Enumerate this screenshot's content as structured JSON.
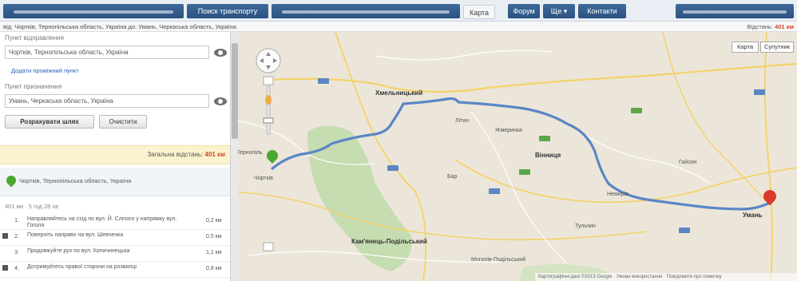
{
  "tabs": {
    "tab1": "",
    "tab2": "Поиск транспорту",
    "tab3": "",
    "tab4": "Карта",
    "tab5": "Форум",
    "tab6": "Ще ▾",
    "tab7": "Контакти",
    "tab8": ""
  },
  "breadcrumb": {
    "route": "від: Чортків, Тернопільська область, Україна  до: Умань, Черкаська область, Україна",
    "distance_label": "Відстань:",
    "distance_value": "401 км"
  },
  "panel": {
    "from_label": "Пункт відправлення",
    "from_value": "Чортків, Тернопільська область, Україна",
    "add_point": "Додати проміжний пункт",
    "to_label": "Пункт призначення",
    "to_value": "Умань, Черкаська область, Україна",
    "calc_button": "Розрахувати шлях",
    "clear_button": "Очистити",
    "total_label": "Загальна відстань:",
    "total_value": "401 км",
    "start_address": "Чортків, Тернопільська область, Україна",
    "summary": "401 км · 5 год 28 хв",
    "steps": [
      {
        "num": "1.",
        "text": "Направляйтесь на схід по вул. Й. Сліпого у напрямку вул. Гоголя",
        "km": "0,2 км"
      },
      {
        "num": "2.",
        "text": "Поверніть направо на вул. Шевченка",
        "km": "0,5 км"
      },
      {
        "num": "3.",
        "text": "Продовжуйте рух по вул. Копичинецька",
        "km": "1,1 км"
      },
      {
        "num": "4.",
        "text": "Дотримуйтесь правої сторони на розвилці",
        "km": "0,8 км"
      }
    ]
  },
  "map": {
    "map_button": "Карта",
    "satellite_button": "Супутник",
    "towns": [
      {
        "name": "Хмельницький",
        "big": true
      },
      {
        "name": "Тернопіль",
        "big": false
      },
      {
        "name": "Кам'янець-Подільський",
        "big": true
      },
      {
        "name": "Вінниця",
        "big": true
      },
      {
        "name": "Умань",
        "big": true
      },
      {
        "name": "Чортків",
        "big": false
      },
      {
        "name": "Літин",
        "big": false
      },
      {
        "name": "Немирів",
        "big": false
      },
      {
        "name": "Бар",
        "big": false
      },
      {
        "name": "Жмеринка",
        "big": false
      },
      {
        "name": "Гайсин",
        "big": false
      },
      {
        "name": "Тульчин",
        "big": false
      },
      {
        "name": "Могилів-Подільський",
        "big": false
      }
    ],
    "footer": "Картографічні дані ©2013 Google · Умови використання · Повідомити про помилку"
  },
  "colors": {
    "tab_blue": "#2f5b8e",
    "route": "#5b86c5",
    "distance_accent": "#d0452b",
    "start_pin": "#4aa832",
    "end_pin": "#d83a2e"
  }
}
